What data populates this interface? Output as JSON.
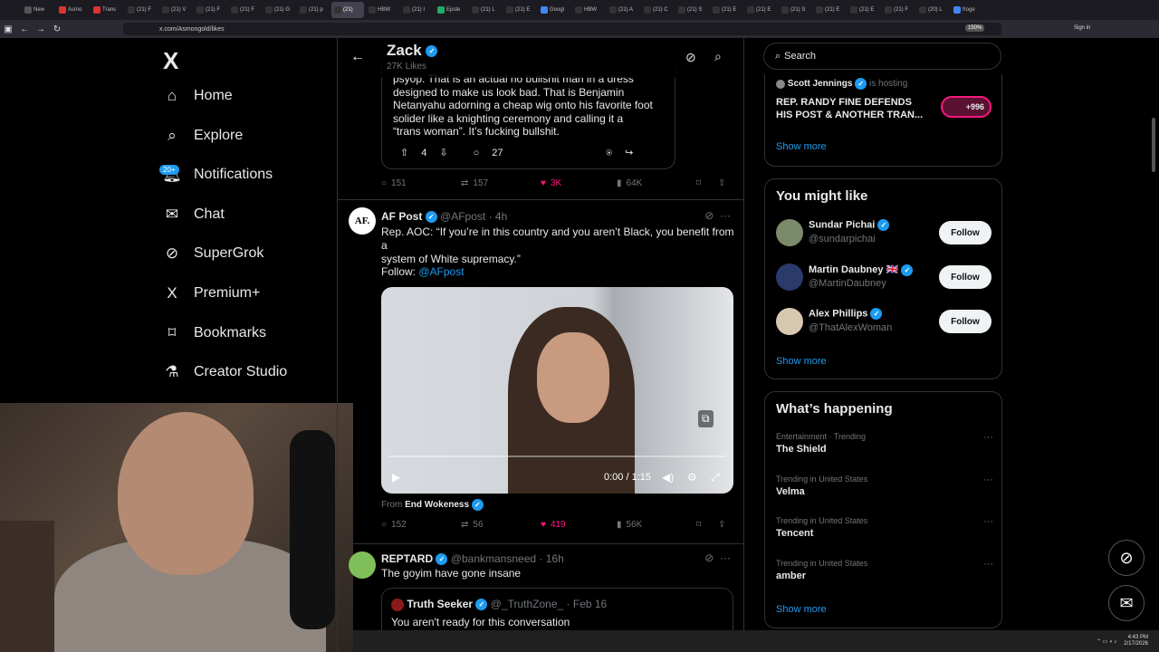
{
  "browser": {
    "tabs": [
      "New",
      "Asmo",
      "Trans",
      "(21) F",
      "(21) V",
      "(21) F",
      "(21) F",
      "(21) G",
      "(21) p",
      "(21)",
      "HBW",
      "(21) I",
      "Epste",
      "(21) L",
      "(21) E",
      "Googl",
      "HBW",
      "(21) A",
      "(21) C",
      "(21) S",
      "(21) E",
      "(21) E",
      "(21) S",
      "(21) E",
      "(21) E",
      "(21) F",
      "(20) L",
      "froge"
    ],
    "url": "x.com/Asmongold/likes",
    "zoom": "150%",
    "sign_in": "Sign in"
  },
  "nav": {
    "logo": "X",
    "items": [
      {
        "label": "Home",
        "icon": "home-icon"
      },
      {
        "label": "Explore",
        "icon": "search-icon"
      },
      {
        "label": "Notifications",
        "icon": "bell-icon"
      },
      {
        "label": "Chat",
        "icon": "mail-icon"
      },
      {
        "label": "SuperGrok",
        "icon": "grok-icon"
      },
      {
        "label": "Premium+",
        "icon": "x-icon"
      },
      {
        "label": "Bookmarks",
        "icon": "bookmark-icon"
      },
      {
        "label": "Creator Studio",
        "icon": "flask-icon"
      }
    ],
    "notif_badge": "20+"
  },
  "header": {
    "name": "Zack",
    "likes": "27K Likes"
  },
  "quoted_post": {
    "text": "psyop. That is an actual no bullshit man in a dress\ndesigned to make us look bad. That is Benjamin\nNetanyahu adorning a cheap wig onto his favorite foot\nsolider like a knighting ceremony and calling it a\n“trans woman”. It’s fucking bullshit.",
    "upvotes": "4",
    "comments": "27"
  },
  "post0_actions": {
    "replies": "151",
    "reposts": "157",
    "likes": "3K",
    "views": "64K"
  },
  "post1": {
    "name": "AF Post",
    "handle": "@AFpost",
    "time": "· 4h",
    "avatar_text": "AF.",
    "text": "Rep. AOC: “If you’re in this country and you aren’t Black, you benefit from a\nsystem of White supremacy.”",
    "follow_prefix": "Follow: ",
    "follow_link": "@AFpost",
    "video_time": "0:00",
    "video_duration": "/ 1:15",
    "from_prefix": "From ",
    "from_name": "End Wokeness",
    "replies": "152",
    "reposts": "56",
    "likes": "419",
    "views": "56K"
  },
  "post2": {
    "name": "REPTARD",
    "handle": "@bankmansneed",
    "time": "· 16h",
    "text": "The goyim have gone insane",
    "quote_name": "Truth Seeker",
    "quote_handle": "@_TruthZone_",
    "quote_time": "· Feb 16",
    "quote_text": "You aren't ready for this conversation"
  },
  "sidebar": {
    "search_placeholder": "Search",
    "space": {
      "host": "Scott Jennings",
      "hosting": "is hosting",
      "title": "REP. RANDY FINE DEFENDS\nHIS POST & ANOTHER TRAN...",
      "count": "+996",
      "show_more": "Show more"
    },
    "who_to_follow": {
      "title": "You might like",
      "users": [
        {
          "name": "Sundar Pichai",
          "handle": "@sundarpichai",
          "follow": "Follow"
        },
        {
          "name": "Martin Daubney",
          "flag": "🇬🇧",
          "handle": "@MartinDaubney",
          "follow": "Follow"
        },
        {
          "name": "Alex Phillips",
          "handle": "@ThatAlexWoman",
          "follow": "Follow"
        }
      ],
      "show_more": "Show more"
    },
    "happening": {
      "title": "What’s happening",
      "trends": [
        {
          "category": "Entertainment · Trending",
          "name": "The Shield"
        },
        {
          "category": "Trending in United States",
          "name": "Velma"
        },
        {
          "category": "Trending in United States",
          "name": "Tencent"
        },
        {
          "category": "Trending in United States",
          "name": "amber"
        }
      ],
      "show_more": "Show more"
    }
  },
  "taskbar": {
    "time": "4:43 PM",
    "date": "2/17/2026"
  },
  "colors": {
    "accent": "#1d9bf0",
    "like": "#f91880",
    "bg": "#000000",
    "border": "#2f3336"
  }
}
